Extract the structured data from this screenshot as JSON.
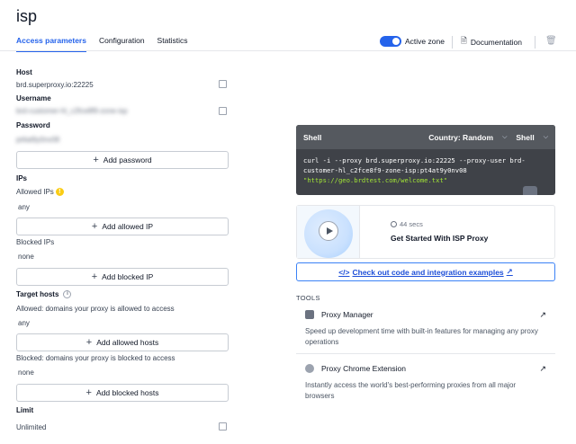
{
  "page": {
    "title": "isp"
  },
  "tabs": [
    {
      "label": "Access parameters",
      "active": true
    },
    {
      "label": "Configuration",
      "active": false
    },
    {
      "label": "Statistics",
      "active": false
    }
  ],
  "header": {
    "active_zone_label": "Active zone",
    "active_zone_on": true,
    "documentation_label": "Documentation"
  },
  "access": {
    "host_label": "Host",
    "host_value": "brd.superproxy.io:22225",
    "username_label": "Username",
    "username_value": "brd-customer-hl_c2fce8f9-zone-isp",
    "password_label": "Password",
    "password_value": "pt4at9y0nv08",
    "add_password_label": "Add password"
  },
  "ips": {
    "section_label": "IPs",
    "allowed_label": "Allowed IPs",
    "allowed_value": "any",
    "add_allowed_label": "Add allowed IP",
    "blocked_label": "Blocked IPs",
    "blocked_value": "none",
    "add_blocked_label": "Add blocked IP"
  },
  "target_hosts": {
    "section_label": "Target hosts",
    "allowed_desc": "Allowed: domains your proxy is allowed to access",
    "allowed_value": "any",
    "add_allowed_label": "Add allowed hosts",
    "blocked_desc": "Blocked: domains your proxy is blocked to access",
    "blocked_value": "none",
    "add_blocked_label": "Add blocked hosts"
  },
  "limit": {
    "label": "Limit",
    "value": "Unlimited"
  },
  "code": {
    "tab_label": "Shell",
    "country_dropdown": "Country: Random",
    "lang_dropdown": "Shell",
    "line1": "curl -i --proxy brd.superproxy.io:22225 --proxy-user brd-",
    "line2": "customer-hl_c2fce8f9-zone-isp:pt4at9y0nv08",
    "line3": "\"https://geo.brdtest.com/welcome.txt\""
  },
  "video": {
    "duration": "44 secs",
    "title": "Get Started With ISP Proxy"
  },
  "cta": {
    "label": "Check out code and integration examples"
  },
  "tools": {
    "section_label": "TOOLS",
    "items": [
      {
        "name": "Proxy Manager",
        "desc": "Speed up development time with built-in features for managing any proxy operations"
      },
      {
        "name": "Proxy Chrome Extension",
        "desc": "Instantly access the world's best-performing proxies from all major browsers"
      }
    ]
  },
  "colors": {
    "accent": "#2563eb",
    "code_bg": "#3f4248",
    "code_string": "#a3e635",
    "warning": "#facc15"
  },
  "icons": [
    "file-icon",
    "trash-icon",
    "copy-icon",
    "warning-icon",
    "info-icon",
    "edit-icon",
    "chevron-down-icon",
    "play-icon",
    "clock-icon",
    "external-link-icon",
    "arrow-up-right-icon",
    "code-icon"
  ]
}
